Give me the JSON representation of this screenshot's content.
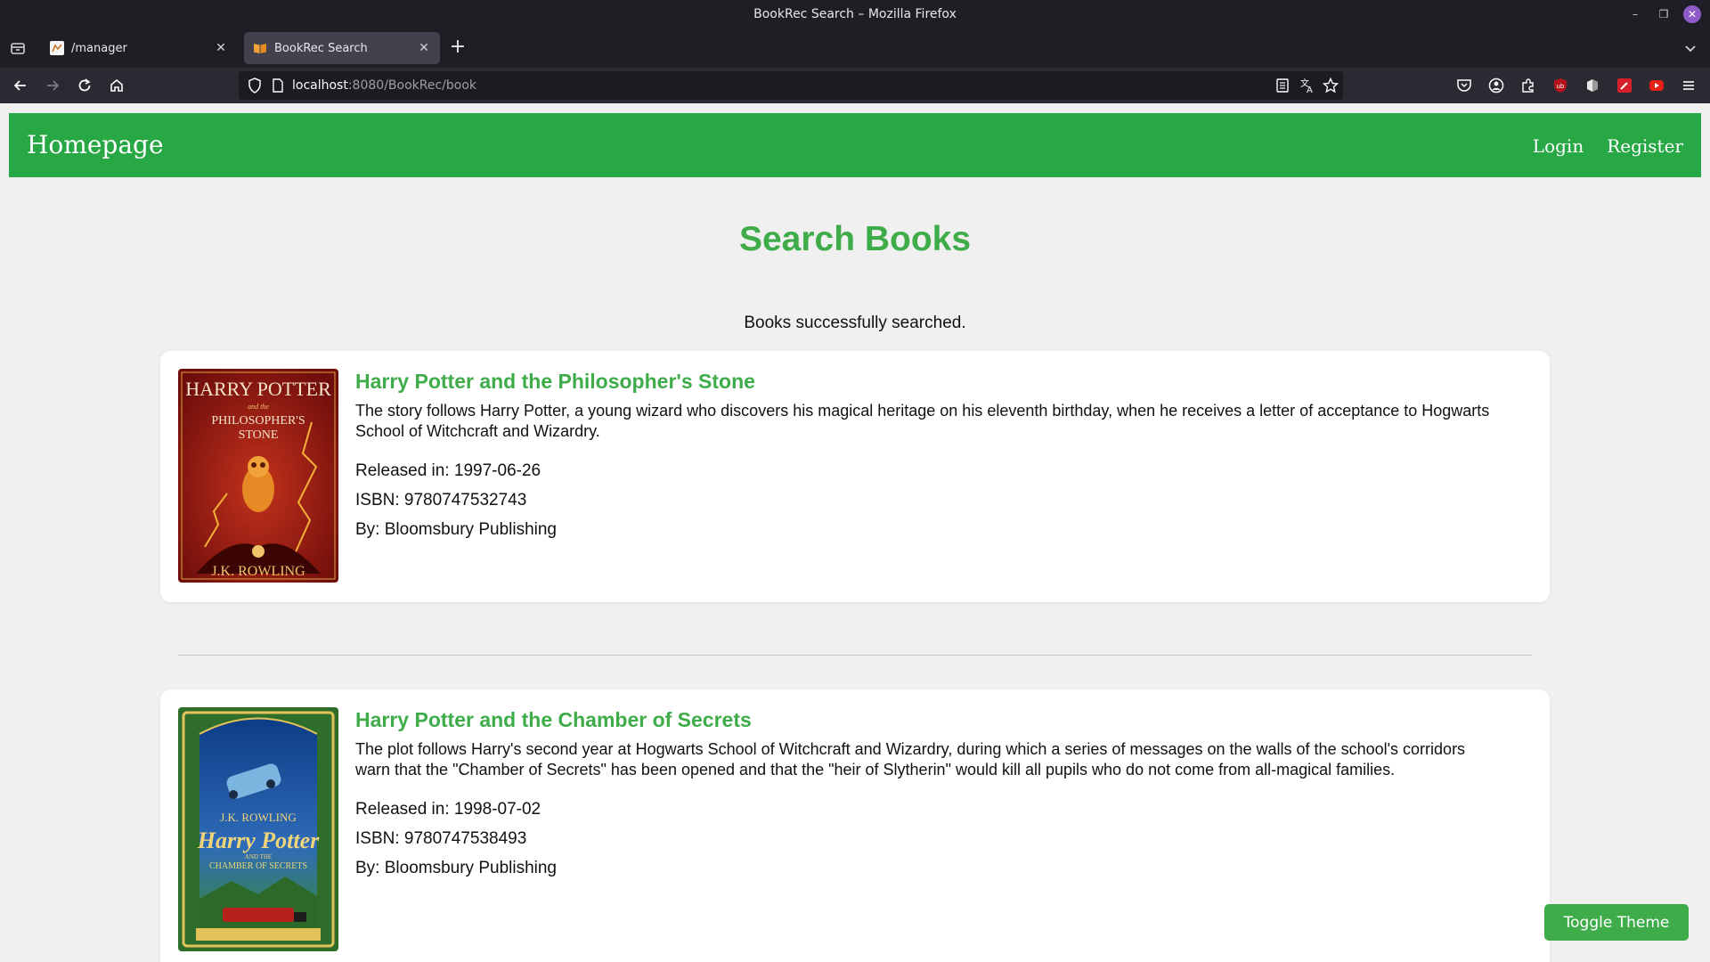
{
  "window": {
    "title": "BookRec Search – Mozilla Firefox"
  },
  "tabs": [
    {
      "label": "/manager"
    },
    {
      "label": "BookRec Search"
    }
  ],
  "address": {
    "host": "localhost",
    "path": ":8080/BookRec/book"
  },
  "site": {
    "brand": "Homepage",
    "login": "Login",
    "register": "Register"
  },
  "page": {
    "title": "Search Books",
    "status": "Books successfully searched."
  },
  "books": [
    {
      "title": "Harry Potter and the Philosopher's Stone",
      "description": "The story follows Harry Potter, a young wizard who discovers his magical heritage on his eleventh birthday, when he receives a letter of acceptance to Hogwarts School of Witchcraft and Wizardry.",
      "released": "Released in: 1997-06-26",
      "isbn": "ISBN: 9780747532743",
      "by": "By: Bloomsbury Publishing",
      "cover": {
        "line1": "HARRY POTTER",
        "line2": "and the",
        "line3": "PHILOSOPHER'S",
        "line4": "STONE",
        "author": "J.K. ROWLING",
        "background": "#8c1512"
      }
    },
    {
      "title": "Harry Potter and the Chamber of Secrets",
      "description": "The plot follows Harry's second year at Hogwarts School of Witchcraft and Wizardry, during which a series of messages on the walls of the school's corridors warn that the \"Chamber of Secrets\" has been opened and that the \"heir of Slytherin\" would kill all pupils who do not come from all-magical families.",
      "released": "Released in: 1998-07-02",
      "isbn": "ISBN: 9780747538493",
      "by": "By: Bloomsbury Publishing",
      "cover": {
        "author": "J.K. ROWLING",
        "line1": "Harry Potter",
        "line2": "AND THE",
        "line3": "CHAMBER OF SECRETS",
        "background": "#2f6e2a"
      }
    }
  ],
  "toggle_theme": "Toggle Theme",
  "colors": {
    "nav_green": "#28a745",
    "accent_green": "#3fac4a",
    "chrome_dark": "#1f1e25"
  }
}
